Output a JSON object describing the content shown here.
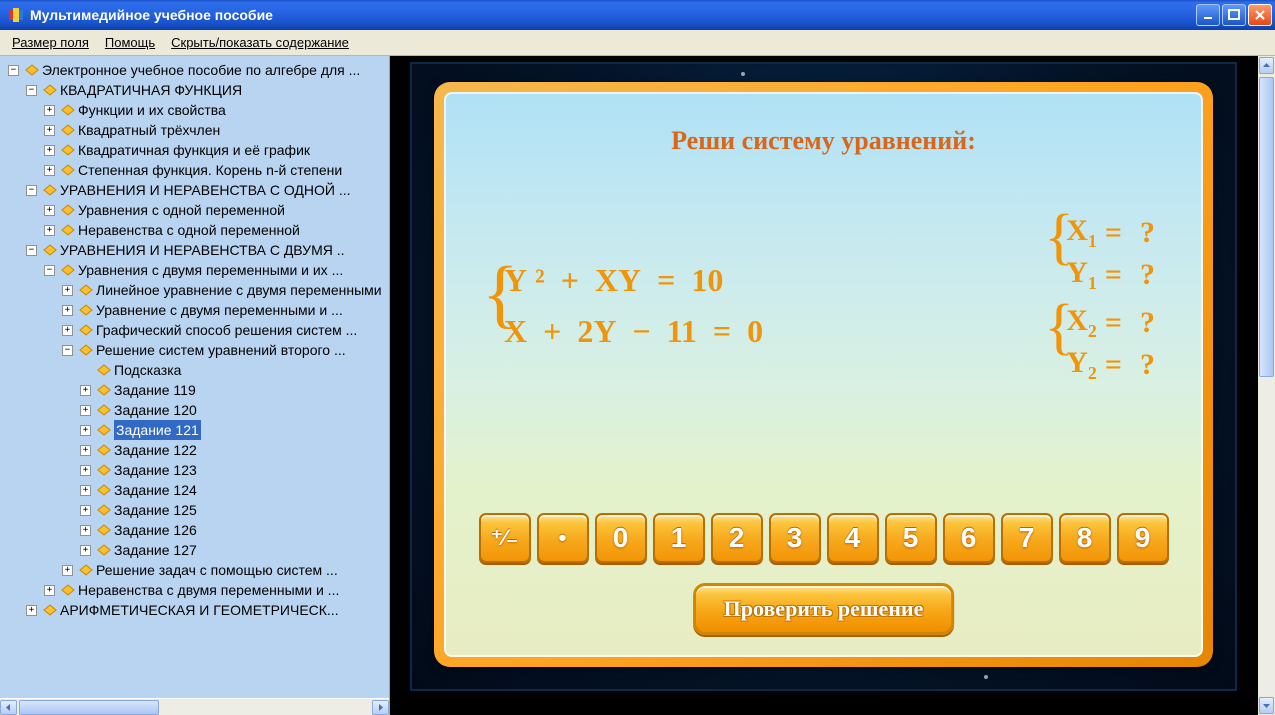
{
  "window": {
    "title": "Мультимедийное учебное пособие"
  },
  "menu": {
    "field_size": "Размер поля",
    "help": "Помощь",
    "toggle_toc": "Скрыть/показать содержание"
  },
  "tree": {
    "root": "Электронное учебное пособие по алгебре для ...",
    "sec1": {
      "title": "КВАДРАТИЧНАЯ ФУНКЦИЯ",
      "items": [
        "Функции и их свойства",
        "Квадратный трёхчлен",
        "Квадратичная функция и её график",
        "Степенная функция. Корень n-й степени"
      ]
    },
    "sec2": {
      "title": "УРАВНЕНИЯ И НЕРАВЕНСТВА С ОДНОЙ ...",
      "items": [
        "Уравнения с одной переменной",
        "Неравенства с одной переменной"
      ]
    },
    "sec3": {
      "title": "УРАВНЕНИЯ И НЕРАВЕНСТВА С ДВУМЯ ..",
      "sub": {
        "title": "Уравнения с двумя переменными и их ...",
        "items": [
          "Линейное уравнение с двумя переменными",
          "Уравнение с двумя переменными и ...",
          "Графический способ решения систем ..."
        ],
        "solving": {
          "title": "Решение систем уравнений второго ...",
          "hint": "Подсказка",
          "tasks": [
            "Задание 119",
            "Задание 120",
            "Задание 121",
            "Задание 122",
            "Задание 123",
            "Задание 124",
            "Задание 125",
            "Задание 126",
            "Задание 127"
          ],
          "selected_index": 2
        },
        "after1": "Решение задач с помощью систем ..."
      },
      "after2": "Неравенства с двумя переменными и ...",
      "cutoff": "АРИФМЕТИЧЕСКАЯ И ГЕОМЕТРИЧЕСК..."
    }
  },
  "task": {
    "title": "Реши систему уравнений:",
    "eq1": "Y ²  +  XY  =  10",
    "eq2": "X  +  2Y  −  11  =  0",
    "answers": {
      "x1": "X",
      "y1": "Y",
      "x2": "X",
      "y2": "Y",
      "sub1": "1",
      "sub2": "2",
      "eq": "=",
      "q": "?"
    },
    "check": "Проверить решение"
  },
  "keypad": [
    "⁺⁄₋",
    "•",
    "0",
    "1",
    "2",
    "3",
    "4",
    "5",
    "6",
    "7",
    "8",
    "9"
  ]
}
